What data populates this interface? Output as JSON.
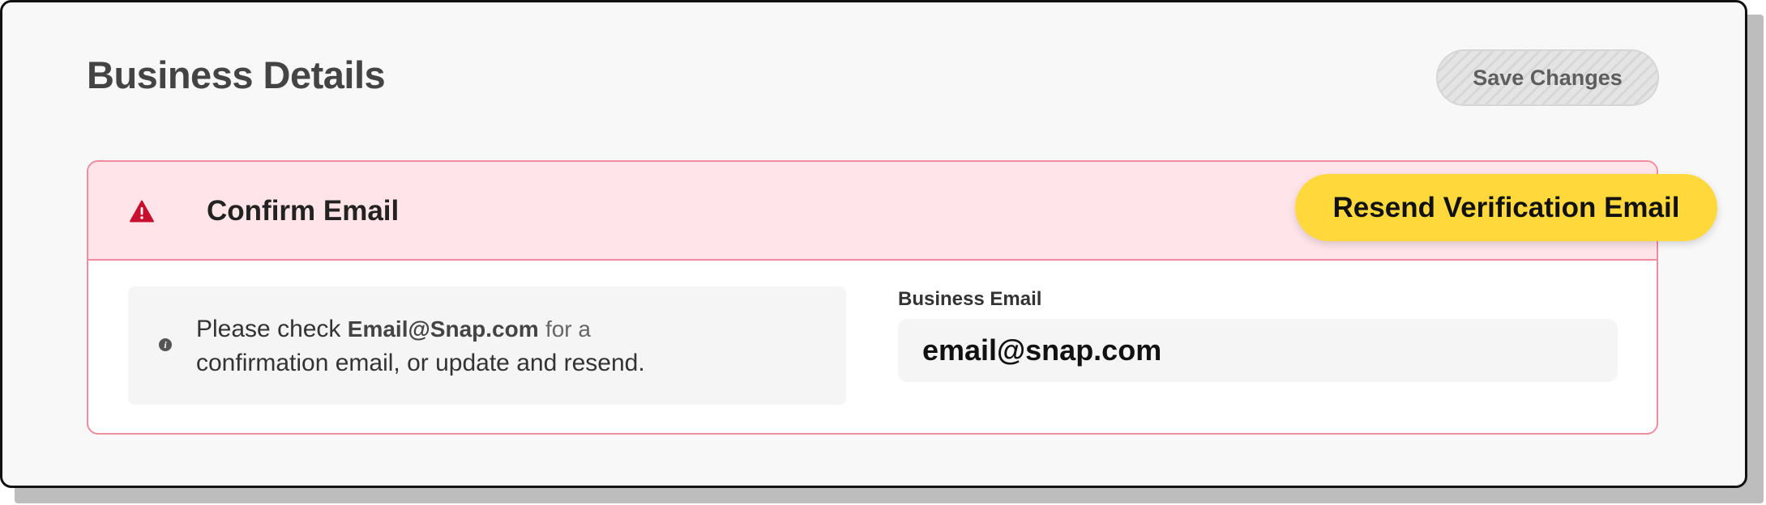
{
  "page": {
    "title": "Business Details",
    "save_label": "Save Changes"
  },
  "alert": {
    "icon": "warning-triangle-icon",
    "title": "Confirm Email",
    "resend_label": "Resend Verification Email",
    "info_icon": "info-icon",
    "message_prefix": "Please check",
    "message_email": "Email@Snap.com",
    "message_mid": "for a",
    "message_suffix": "confirmation email, or update and resend."
  },
  "form": {
    "email_label": "Business Email",
    "email_value": "email@snap.com"
  },
  "colors": {
    "alert_bg": "#ffe5e9",
    "alert_border": "#ef8ca0",
    "warning_icon": "#c8102e",
    "primary_button": "#ffd93b"
  }
}
